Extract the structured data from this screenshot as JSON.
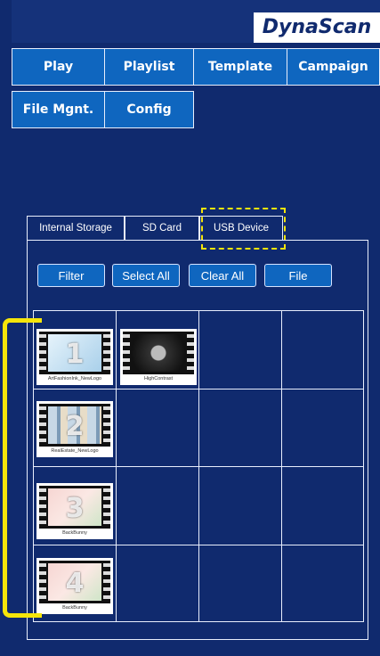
{
  "brand": {
    "logo_text": "DynaScan"
  },
  "nav": {
    "items": [
      "Play",
      "Playlist",
      "Template",
      "Campaign",
      "File Mgnt.",
      "Config"
    ]
  },
  "storage_tabs": [
    "Internal Storage",
    "SD Card",
    "USB Device"
  ],
  "selected_tab": "USB Device",
  "actions": {
    "filter": "Filter",
    "select_all": "Select All",
    "clear_all": "Clear All",
    "file": "File"
  },
  "files": [
    {
      "caption": "ArtFashionInk_NewLogo",
      "number": "1",
      "theme": "#cfe6f5"
    },
    {
      "caption": "HighContrast",
      "number": "",
      "theme": "#222"
    },
    {
      "caption": "RealEstate_NewLogo",
      "number": "2",
      "theme": "#9ab6cf"
    },
    {
      "caption": "BackBunny",
      "number": "3",
      "theme": "#f3c9c9"
    },
    {
      "caption": "BackBunny",
      "number": "4",
      "theme": "#f3c9c9"
    }
  ],
  "colors": {
    "background": "#102a6e",
    "button": "#0f66bf",
    "highlight": "#f5e50a"
  }
}
